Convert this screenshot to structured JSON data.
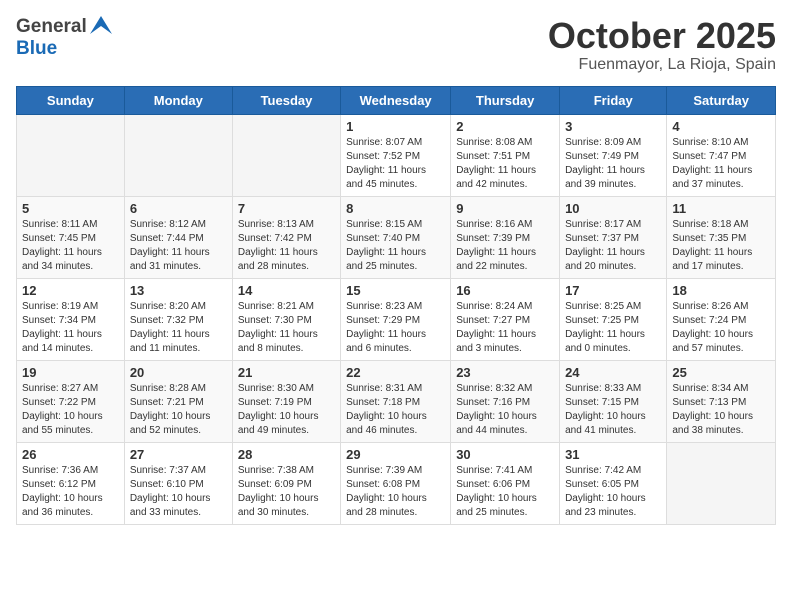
{
  "header": {
    "logo_general": "General",
    "logo_blue": "Blue",
    "month_title": "October 2025",
    "location": "Fuenmayor, La Rioja, Spain"
  },
  "weekdays": [
    "Sunday",
    "Monday",
    "Tuesday",
    "Wednesday",
    "Thursday",
    "Friday",
    "Saturday"
  ],
  "weeks": [
    [
      {
        "day": "",
        "sunrise": "",
        "sunset": "",
        "daylight": "",
        "empty": true
      },
      {
        "day": "",
        "sunrise": "",
        "sunset": "",
        "daylight": "",
        "empty": true
      },
      {
        "day": "",
        "sunrise": "",
        "sunset": "",
        "daylight": "",
        "empty": true
      },
      {
        "day": "1",
        "sunrise": "Sunrise: 8:07 AM",
        "sunset": "Sunset: 7:52 PM",
        "daylight": "Daylight: 11 hours and 45 minutes."
      },
      {
        "day": "2",
        "sunrise": "Sunrise: 8:08 AM",
        "sunset": "Sunset: 7:51 PM",
        "daylight": "Daylight: 11 hours and 42 minutes."
      },
      {
        "day": "3",
        "sunrise": "Sunrise: 8:09 AM",
        "sunset": "Sunset: 7:49 PM",
        "daylight": "Daylight: 11 hours and 39 minutes."
      },
      {
        "day": "4",
        "sunrise": "Sunrise: 8:10 AM",
        "sunset": "Sunset: 7:47 PM",
        "daylight": "Daylight: 11 hours and 37 minutes."
      }
    ],
    [
      {
        "day": "5",
        "sunrise": "Sunrise: 8:11 AM",
        "sunset": "Sunset: 7:45 PM",
        "daylight": "Daylight: 11 hours and 34 minutes."
      },
      {
        "day": "6",
        "sunrise": "Sunrise: 8:12 AM",
        "sunset": "Sunset: 7:44 PM",
        "daylight": "Daylight: 11 hours and 31 minutes."
      },
      {
        "day": "7",
        "sunrise": "Sunrise: 8:13 AM",
        "sunset": "Sunset: 7:42 PM",
        "daylight": "Daylight: 11 hours and 28 minutes."
      },
      {
        "day": "8",
        "sunrise": "Sunrise: 8:15 AM",
        "sunset": "Sunset: 7:40 PM",
        "daylight": "Daylight: 11 hours and 25 minutes."
      },
      {
        "day": "9",
        "sunrise": "Sunrise: 8:16 AM",
        "sunset": "Sunset: 7:39 PM",
        "daylight": "Daylight: 11 hours and 22 minutes."
      },
      {
        "day": "10",
        "sunrise": "Sunrise: 8:17 AM",
        "sunset": "Sunset: 7:37 PM",
        "daylight": "Daylight: 11 hours and 20 minutes."
      },
      {
        "day": "11",
        "sunrise": "Sunrise: 8:18 AM",
        "sunset": "Sunset: 7:35 PM",
        "daylight": "Daylight: 11 hours and 17 minutes."
      }
    ],
    [
      {
        "day": "12",
        "sunrise": "Sunrise: 8:19 AM",
        "sunset": "Sunset: 7:34 PM",
        "daylight": "Daylight: 11 hours and 14 minutes."
      },
      {
        "day": "13",
        "sunrise": "Sunrise: 8:20 AM",
        "sunset": "Sunset: 7:32 PM",
        "daylight": "Daylight: 11 hours and 11 minutes."
      },
      {
        "day": "14",
        "sunrise": "Sunrise: 8:21 AM",
        "sunset": "Sunset: 7:30 PM",
        "daylight": "Daylight: 11 hours and 8 minutes."
      },
      {
        "day": "15",
        "sunrise": "Sunrise: 8:23 AM",
        "sunset": "Sunset: 7:29 PM",
        "daylight": "Daylight: 11 hours and 6 minutes."
      },
      {
        "day": "16",
        "sunrise": "Sunrise: 8:24 AM",
        "sunset": "Sunset: 7:27 PM",
        "daylight": "Daylight: 11 hours and 3 minutes."
      },
      {
        "day": "17",
        "sunrise": "Sunrise: 8:25 AM",
        "sunset": "Sunset: 7:25 PM",
        "daylight": "Daylight: 11 hours and 0 minutes."
      },
      {
        "day": "18",
        "sunrise": "Sunrise: 8:26 AM",
        "sunset": "Sunset: 7:24 PM",
        "daylight": "Daylight: 10 hours and 57 minutes."
      }
    ],
    [
      {
        "day": "19",
        "sunrise": "Sunrise: 8:27 AM",
        "sunset": "Sunset: 7:22 PM",
        "daylight": "Daylight: 10 hours and 55 minutes."
      },
      {
        "day": "20",
        "sunrise": "Sunrise: 8:28 AM",
        "sunset": "Sunset: 7:21 PM",
        "daylight": "Daylight: 10 hours and 52 minutes."
      },
      {
        "day": "21",
        "sunrise": "Sunrise: 8:30 AM",
        "sunset": "Sunset: 7:19 PM",
        "daylight": "Daylight: 10 hours and 49 minutes."
      },
      {
        "day": "22",
        "sunrise": "Sunrise: 8:31 AM",
        "sunset": "Sunset: 7:18 PM",
        "daylight": "Daylight: 10 hours and 46 minutes."
      },
      {
        "day": "23",
        "sunrise": "Sunrise: 8:32 AM",
        "sunset": "Sunset: 7:16 PM",
        "daylight": "Daylight: 10 hours and 44 minutes."
      },
      {
        "day": "24",
        "sunrise": "Sunrise: 8:33 AM",
        "sunset": "Sunset: 7:15 PM",
        "daylight": "Daylight: 10 hours and 41 minutes."
      },
      {
        "day": "25",
        "sunrise": "Sunrise: 8:34 AM",
        "sunset": "Sunset: 7:13 PM",
        "daylight": "Daylight: 10 hours and 38 minutes."
      }
    ],
    [
      {
        "day": "26",
        "sunrise": "Sunrise: 7:36 AM",
        "sunset": "Sunset: 6:12 PM",
        "daylight": "Daylight: 10 hours and 36 minutes."
      },
      {
        "day": "27",
        "sunrise": "Sunrise: 7:37 AM",
        "sunset": "Sunset: 6:10 PM",
        "daylight": "Daylight: 10 hours and 33 minutes."
      },
      {
        "day": "28",
        "sunrise": "Sunrise: 7:38 AM",
        "sunset": "Sunset: 6:09 PM",
        "daylight": "Daylight: 10 hours and 30 minutes."
      },
      {
        "day": "29",
        "sunrise": "Sunrise: 7:39 AM",
        "sunset": "Sunset: 6:08 PM",
        "daylight": "Daylight: 10 hours and 28 minutes."
      },
      {
        "day": "30",
        "sunrise": "Sunrise: 7:41 AM",
        "sunset": "Sunset: 6:06 PM",
        "daylight": "Daylight: 10 hours and 25 minutes."
      },
      {
        "day": "31",
        "sunrise": "Sunrise: 7:42 AM",
        "sunset": "Sunset: 6:05 PM",
        "daylight": "Daylight: 10 hours and 23 minutes."
      },
      {
        "day": "",
        "sunrise": "",
        "sunset": "",
        "daylight": "",
        "empty": true
      }
    ]
  ]
}
